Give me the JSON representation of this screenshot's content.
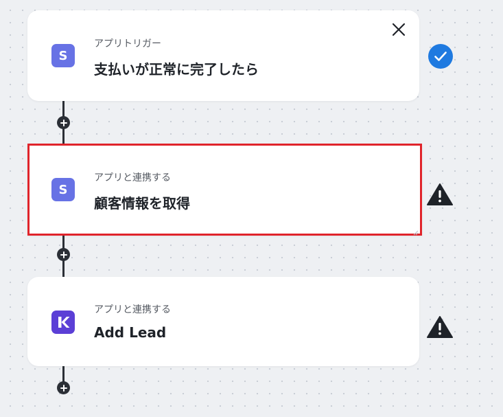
{
  "colors": {
    "stripe_brand": "#6772e5",
    "kaleido_brand": "#5b3fd6",
    "success": "#1f7ae0",
    "warning": "#1f2329",
    "selection": "#e0242b",
    "connector": "#2b2f36"
  },
  "steps": [
    {
      "subtitle": "アプリトリガー",
      "title": "支払いが正常に完了したら",
      "app_icon": "stripe-icon",
      "status_icon": "check-circle-icon"
    },
    {
      "subtitle": "アプリと連携する",
      "title": "顧客情報を取得",
      "app_icon": "stripe-icon",
      "status_icon": "warning-triangle-icon"
    },
    {
      "subtitle": "アプリと連携する",
      "title": "Add Lead",
      "app_icon": "kaleido-k-icon",
      "status_icon": "warning-triangle-icon"
    }
  ]
}
